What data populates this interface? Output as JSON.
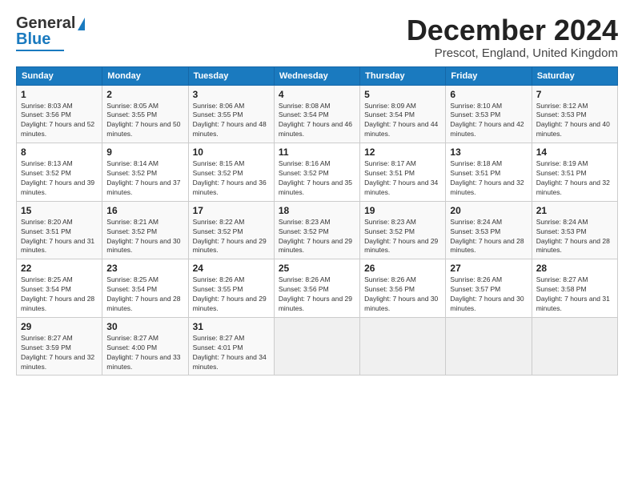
{
  "logo": {
    "line1": "General",
    "line2": "Blue"
  },
  "header": {
    "month": "December 2024",
    "location": "Prescot, England, United Kingdom"
  },
  "weekdays": [
    "Sunday",
    "Monday",
    "Tuesday",
    "Wednesday",
    "Thursday",
    "Friday",
    "Saturday"
  ],
  "weeks": [
    [
      {
        "day": "1",
        "sunrise": "8:03 AM",
        "sunset": "3:56 PM",
        "daylight": "7 hours and 52 minutes."
      },
      {
        "day": "2",
        "sunrise": "8:05 AM",
        "sunset": "3:55 PM",
        "daylight": "7 hours and 50 minutes."
      },
      {
        "day": "3",
        "sunrise": "8:06 AM",
        "sunset": "3:55 PM",
        "daylight": "7 hours and 48 minutes."
      },
      {
        "day": "4",
        "sunrise": "8:08 AM",
        "sunset": "3:54 PM",
        "daylight": "7 hours and 46 minutes."
      },
      {
        "day": "5",
        "sunrise": "8:09 AM",
        "sunset": "3:54 PM",
        "daylight": "7 hours and 44 minutes."
      },
      {
        "day": "6",
        "sunrise": "8:10 AM",
        "sunset": "3:53 PM",
        "daylight": "7 hours and 42 minutes."
      },
      {
        "day": "7",
        "sunrise": "8:12 AM",
        "sunset": "3:53 PM",
        "daylight": "7 hours and 40 minutes."
      }
    ],
    [
      {
        "day": "8",
        "sunrise": "8:13 AM",
        "sunset": "3:52 PM",
        "daylight": "7 hours and 39 minutes."
      },
      {
        "day": "9",
        "sunrise": "8:14 AM",
        "sunset": "3:52 PM",
        "daylight": "7 hours and 37 minutes."
      },
      {
        "day": "10",
        "sunrise": "8:15 AM",
        "sunset": "3:52 PM",
        "daylight": "7 hours and 36 minutes."
      },
      {
        "day": "11",
        "sunrise": "8:16 AM",
        "sunset": "3:52 PM",
        "daylight": "7 hours and 35 minutes."
      },
      {
        "day": "12",
        "sunrise": "8:17 AM",
        "sunset": "3:51 PM",
        "daylight": "7 hours and 34 minutes."
      },
      {
        "day": "13",
        "sunrise": "8:18 AM",
        "sunset": "3:51 PM",
        "daylight": "7 hours and 32 minutes."
      },
      {
        "day": "14",
        "sunrise": "8:19 AM",
        "sunset": "3:51 PM",
        "daylight": "7 hours and 32 minutes."
      }
    ],
    [
      {
        "day": "15",
        "sunrise": "8:20 AM",
        "sunset": "3:51 PM",
        "daylight": "7 hours and 31 minutes."
      },
      {
        "day": "16",
        "sunrise": "8:21 AM",
        "sunset": "3:52 PM",
        "daylight": "7 hours and 30 minutes."
      },
      {
        "day": "17",
        "sunrise": "8:22 AM",
        "sunset": "3:52 PM",
        "daylight": "7 hours and 29 minutes."
      },
      {
        "day": "18",
        "sunrise": "8:23 AM",
        "sunset": "3:52 PM",
        "daylight": "7 hours and 29 minutes."
      },
      {
        "day": "19",
        "sunrise": "8:23 AM",
        "sunset": "3:52 PM",
        "daylight": "7 hours and 29 minutes."
      },
      {
        "day": "20",
        "sunrise": "8:24 AM",
        "sunset": "3:53 PM",
        "daylight": "7 hours and 28 minutes."
      },
      {
        "day": "21",
        "sunrise": "8:24 AM",
        "sunset": "3:53 PM",
        "daylight": "7 hours and 28 minutes."
      }
    ],
    [
      {
        "day": "22",
        "sunrise": "8:25 AM",
        "sunset": "3:54 PM",
        "daylight": "7 hours and 28 minutes."
      },
      {
        "day": "23",
        "sunrise": "8:25 AM",
        "sunset": "3:54 PM",
        "daylight": "7 hours and 28 minutes."
      },
      {
        "day": "24",
        "sunrise": "8:26 AM",
        "sunset": "3:55 PM",
        "daylight": "7 hours and 29 minutes."
      },
      {
        "day": "25",
        "sunrise": "8:26 AM",
        "sunset": "3:56 PM",
        "daylight": "7 hours and 29 minutes."
      },
      {
        "day": "26",
        "sunrise": "8:26 AM",
        "sunset": "3:56 PM",
        "daylight": "7 hours and 30 minutes."
      },
      {
        "day": "27",
        "sunrise": "8:26 AM",
        "sunset": "3:57 PM",
        "daylight": "7 hours and 30 minutes."
      },
      {
        "day": "28",
        "sunrise": "8:27 AM",
        "sunset": "3:58 PM",
        "daylight": "7 hours and 31 minutes."
      }
    ],
    [
      {
        "day": "29",
        "sunrise": "8:27 AM",
        "sunset": "3:59 PM",
        "daylight": "7 hours and 32 minutes."
      },
      {
        "day": "30",
        "sunrise": "8:27 AM",
        "sunset": "4:00 PM",
        "daylight": "7 hours and 33 minutes."
      },
      {
        "day": "31",
        "sunrise": "8:27 AM",
        "sunset": "4:01 PM",
        "daylight": "7 hours and 34 minutes."
      },
      null,
      null,
      null,
      null
    ]
  ]
}
